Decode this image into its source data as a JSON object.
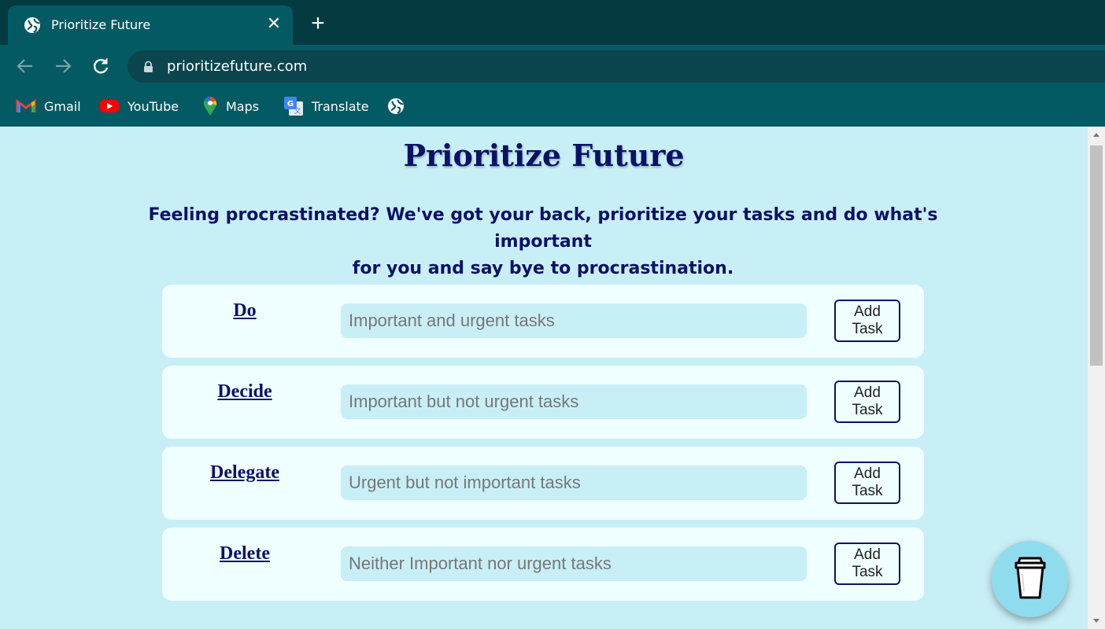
{
  "browser": {
    "tab_title": "Prioritize Future",
    "url": "prioritizefuture.com",
    "bookmarks": [
      {
        "label": "Gmail",
        "icon": "gmail-icon"
      },
      {
        "label": "YouTube",
        "icon": "youtube-icon"
      },
      {
        "label": "Maps",
        "icon": "maps-icon"
      },
      {
        "label": "Translate",
        "icon": "translate-icon"
      },
      {
        "label": "",
        "icon": "globe-icon"
      }
    ],
    "colors": {
      "tabstrip": "#033a42",
      "toolbar": "#045a62",
      "omnibox": "#0b454d"
    }
  },
  "page": {
    "title": "Prioritize Future",
    "tagline_line1": "Feeling procrastinated? We've got your back, prioritize your tasks and do what's important",
    "tagline_line2": "for you and say bye to procrastination.",
    "categories": [
      {
        "label": "Do",
        "placeholder": "Important and urgent tasks",
        "button_line1": "Add",
        "button_line2": "Task"
      },
      {
        "label": "Decide",
        "placeholder": "Important but not urgent tasks",
        "button_line1": "Add",
        "button_line2": "Task"
      },
      {
        "label": "Delegate",
        "placeholder": "Urgent but not important tasks",
        "button_line1": "Add",
        "button_line2": "Task"
      },
      {
        "label": "Delete",
        "placeholder": "Neither Important nor urgent tasks",
        "button_line1": "Add",
        "button_line2": "Task"
      }
    ],
    "colors": {
      "background": "#c9eff6",
      "card": "#f0ffff",
      "heading": "#0b1265",
      "coffee_button": "#8fdcee"
    }
  }
}
